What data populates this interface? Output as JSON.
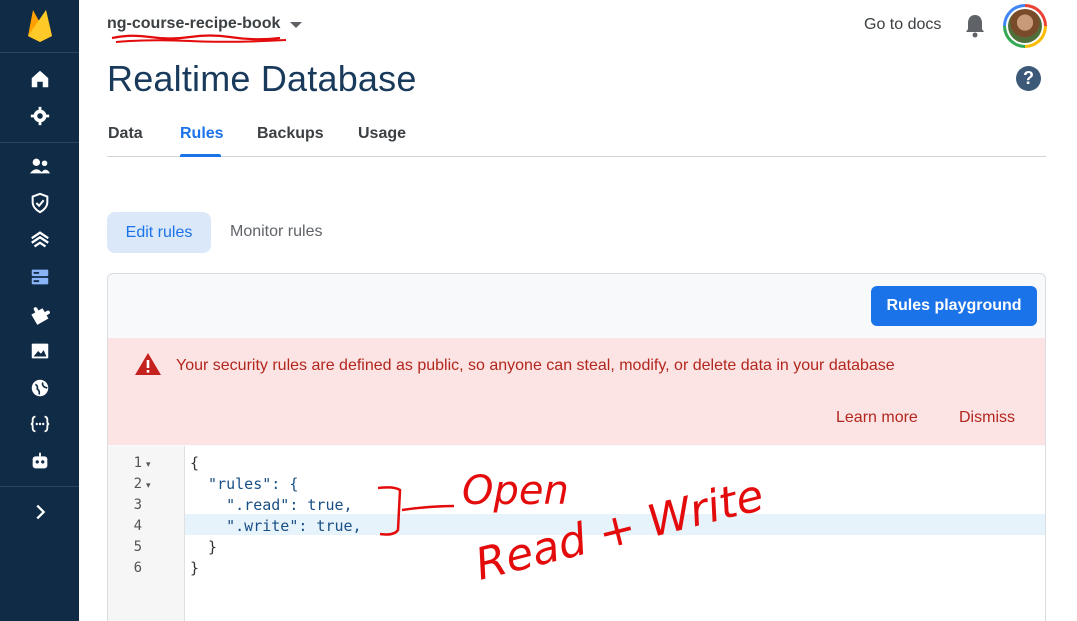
{
  "sidebar": {
    "items": [
      {
        "icon": "home-icon"
      },
      {
        "icon": "settings-icon"
      },
      {
        "icon": "users-icon"
      },
      {
        "icon": "shield-icon"
      },
      {
        "icon": "hosting-icon"
      },
      {
        "icon": "database-icon"
      },
      {
        "icon": "extensions-icon"
      },
      {
        "icon": "storage-icon"
      },
      {
        "icon": "globe-icon"
      },
      {
        "icon": "functions-icon"
      },
      {
        "icon": "robot-icon"
      }
    ],
    "expand_icon": "chevron-right-icon"
  },
  "header": {
    "project_name": "ng-course-recipe-book",
    "go_to_docs": "Go to docs",
    "page_title": "Realtime Database",
    "help": "?"
  },
  "tabs": [
    "Data",
    "Rules",
    "Backups",
    "Usage"
  ],
  "active_tab": "Rules",
  "subtabs": {
    "edit": "Edit rules",
    "monitor": "Monitor rules"
  },
  "rules_card": {
    "playground_button": "Rules playground",
    "warning": {
      "message": "Your security rules are defined as public, so anyone can steal, modify, or delete data in your database",
      "learn_more": "Learn more",
      "dismiss": "Dismiss"
    },
    "editor": {
      "line_numbers": [
        "1",
        "2",
        "3",
        "4",
        "5",
        "6"
      ],
      "lines": [
        "{",
        "  \"rules\": {",
        "    \".read\": true,",
        "    \".write\": true,",
        "  }",
        "}"
      ]
    }
  },
  "annotation": {
    "line1": "Open",
    "line2": "Read + Write",
    "color": "#e30b0b"
  },
  "colors": {
    "sidebar_bg": "#0f2b46",
    "accent": "#1a73e8",
    "warning_bg": "#fbe4e3",
    "warning_text": "#b3261e"
  }
}
